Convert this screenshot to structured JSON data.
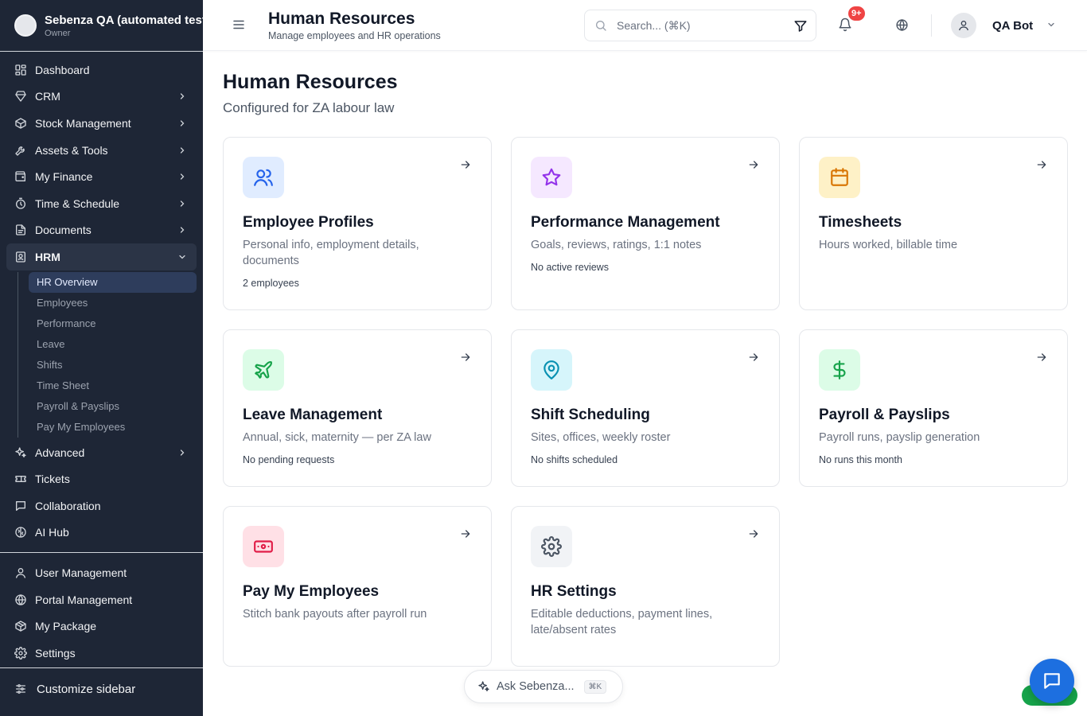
{
  "org": {
    "name": "Sebenza QA (automated tests)",
    "role": "Owner"
  },
  "sidebar": {
    "items": [
      {
        "label": "Dashboard",
        "icon": "dashboard-icon",
        "chevron": false
      },
      {
        "label": "CRM",
        "icon": "gem-icon",
        "chevron": true
      },
      {
        "label": "Stock Management",
        "icon": "box-icon",
        "chevron": true
      },
      {
        "label": "Assets & Tools",
        "icon": "wrench-icon",
        "chevron": true
      },
      {
        "label": "My Finance",
        "icon": "wallet-icon",
        "chevron": true
      },
      {
        "label": "Time & Schedule",
        "icon": "timer-icon",
        "chevron": true
      },
      {
        "label": "Documents",
        "icon": "document-icon",
        "chevron": true
      },
      {
        "label": "HRM",
        "icon": "id-badge-icon",
        "chevron": true,
        "expanded": true
      }
    ],
    "hrm_sub": [
      {
        "label": "HR Overview",
        "active": true
      },
      {
        "label": "Employees"
      },
      {
        "label": "Performance"
      },
      {
        "label": "Leave"
      },
      {
        "label": "Shifts"
      },
      {
        "label": "Time Sheet"
      },
      {
        "label": "Payroll & Payslips"
      },
      {
        "label": "Pay My Employees"
      }
    ],
    "after_items": [
      {
        "label": "Advanced",
        "icon": "sparkles-icon",
        "chevron": true
      },
      {
        "label": "Tickets",
        "icon": "ticket-icon",
        "chevron": false
      },
      {
        "label": "Collaboration",
        "icon": "chat-icon",
        "chevron": false
      },
      {
        "label": "AI Hub",
        "icon": "brain-icon",
        "chevron": false
      }
    ],
    "admin_items": [
      {
        "label": "User Management",
        "icon": "user-icon"
      },
      {
        "label": "Portal Management",
        "icon": "globe-icon"
      },
      {
        "label": "My Package",
        "icon": "package-icon"
      },
      {
        "label": "Settings",
        "icon": "gear-icon"
      }
    ],
    "customize_label": "Customize sidebar"
  },
  "header": {
    "title": "Human Resources",
    "subtitle": "Manage employees and HR operations",
    "search_placeholder": "Search... (⌘K)",
    "notification_badge": "9+",
    "user_name": "QA Bot"
  },
  "main": {
    "title": "Human Resources",
    "subtitle": "Configured for ZA labour law",
    "cards": [
      {
        "title": "Employee Profiles",
        "desc": "Personal info, employment details, documents",
        "meta": "2 employees",
        "icon": "users-icon",
        "tile_bg": "#e0ecff",
        "icon_color": "#2563eb"
      },
      {
        "title": "Performance Management",
        "desc": "Goals, reviews, ratings, 1:1 notes",
        "meta": "No active reviews",
        "icon": "star-icon",
        "tile_bg": "#f5e8ff",
        "icon_color": "#9333ea"
      },
      {
        "title": "Timesheets",
        "desc": "Hours worked, billable time",
        "meta": "",
        "icon": "calendar-icon",
        "tile_bg": "#fef1c7",
        "icon_color": "#d97706"
      },
      {
        "title": "Leave Management",
        "desc": "Annual, sick, maternity — per ZA law",
        "meta": "No pending requests",
        "icon": "plane-icon",
        "tile_bg": "#dcfce7",
        "icon_color": "#16a34a"
      },
      {
        "title": "Shift Scheduling",
        "desc": "Sites, offices, weekly roster",
        "meta": "No shifts scheduled",
        "icon": "map-pin-icon",
        "tile_bg": "#d6f5fb",
        "icon_color": "#0891b2"
      },
      {
        "title": "Payroll & Payslips",
        "desc": "Payroll runs, payslip generation",
        "meta": "No runs this month",
        "icon": "dollar-icon",
        "tile_bg": "#dcfce7",
        "icon_color": "#16a34a"
      },
      {
        "title": "Pay My Employees",
        "desc": "Stitch bank payouts after payroll run",
        "meta": "",
        "icon": "banknote-icon",
        "tile_bg": "#ffe0e6",
        "icon_color": "#e11d48"
      },
      {
        "title": "HR Settings",
        "desc": "Editable deductions, payment lines, late/absent rates",
        "meta": "",
        "icon": "gear-icon",
        "tile_bg": "#f1f3f6",
        "icon_color": "#4b5563"
      }
    ]
  },
  "ask": {
    "label": "Ask Sebenza...",
    "kbd": "⌘K"
  },
  "colors": {
    "sidebar_bg": "#1e2636",
    "accent": "#1d6fe0",
    "badge": "#ef4444"
  }
}
